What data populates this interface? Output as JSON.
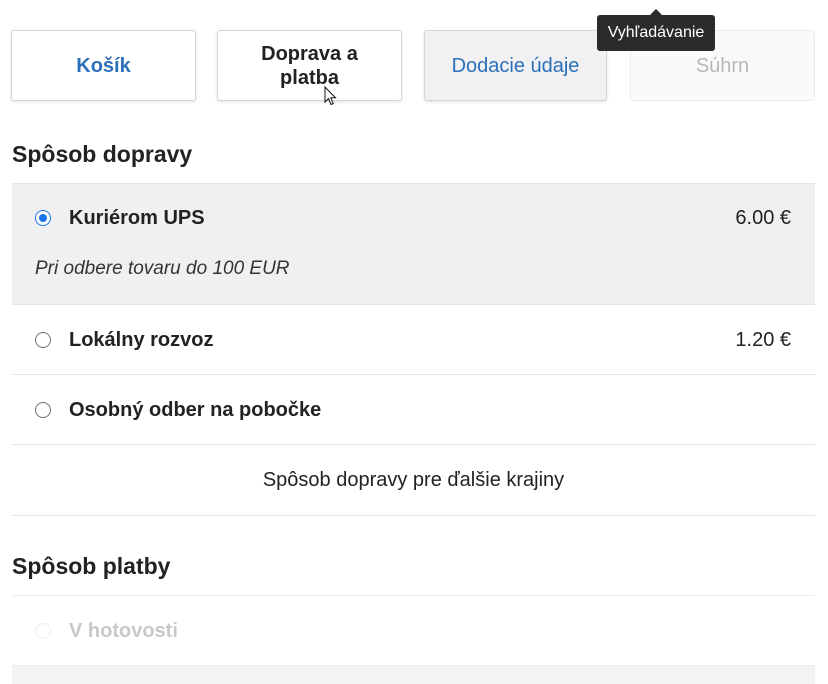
{
  "steps": [
    {
      "label": "Košík"
    },
    {
      "label": "Doprava a platba"
    },
    {
      "label": "Dodacie údaje"
    },
    {
      "label": "Súhrn"
    }
  ],
  "tooltip": "Vyhľadávanie",
  "shipping": {
    "heading": "Spôsob dopravy",
    "options": [
      {
        "name": "Kuriérom UPS",
        "price": "6.00 €",
        "note": "Pri odbere tovaru do 100 EUR",
        "selected": true
      },
      {
        "name": "Lokálny rozvoz",
        "price": "1.20 €",
        "selected": false
      },
      {
        "name": "Osobný odber na pobočke",
        "price": "",
        "selected": false
      }
    ],
    "other_countries": "Spôsob dopravy pre ďalšie krajiny"
  },
  "payment": {
    "heading": "Spôsob platby",
    "options": [
      {
        "name": "V hotovosti",
        "selected": false
      }
    ]
  },
  "colors": {
    "accent": "#2c6fbb",
    "radio_selected": "#1a73e8",
    "selected_bg": "#f0f0f2"
  }
}
